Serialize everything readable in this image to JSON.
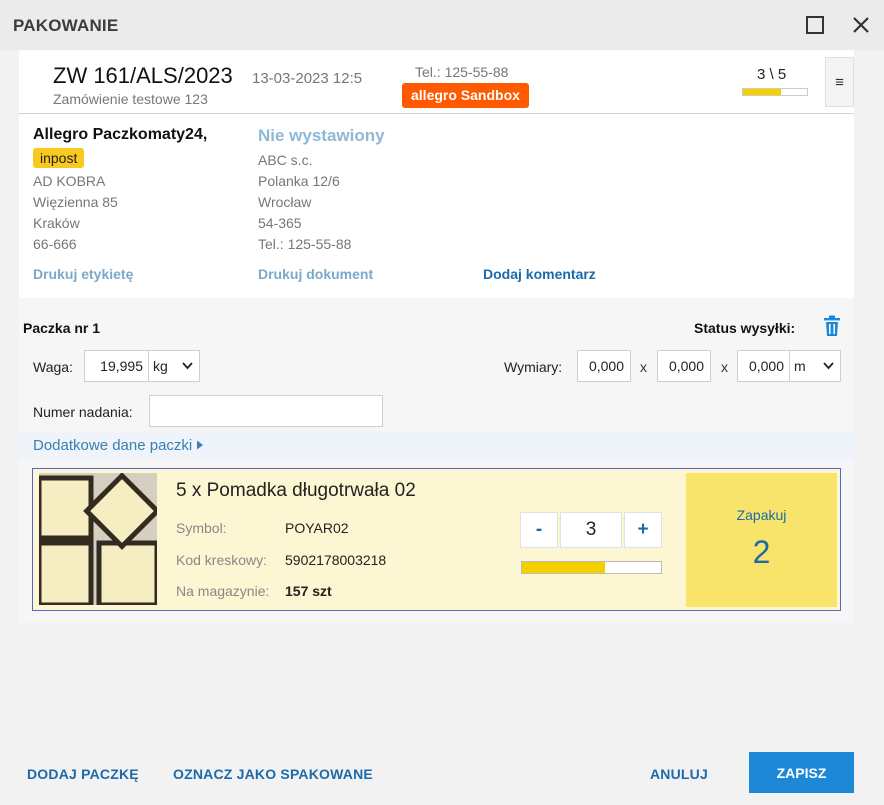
{
  "window": {
    "title": "PAKOWANIE"
  },
  "order": {
    "number": "ZW 161/ALS/2023",
    "date": "13-03-2023 12:5",
    "description": "Zamówienie testowe 123",
    "tel": "Tel.: 125-55-88",
    "source_badge": "allegro Sandbox",
    "counter": "3 \\ 5",
    "counter_progress": 0.6,
    "menu_icon": "≡"
  },
  "shipping": {
    "carrier": "Allegro Paczkomaty24,",
    "carrier_badge": "inpost",
    "address": [
      "AD KOBRA",
      "Więzienna 85",
      "Kraków",
      "66-666"
    ]
  },
  "document": {
    "status": "Nie wystawiony",
    "address": [
      "ABC s.c.",
      "Polanka 12/6",
      "Wrocław",
      "54-365",
      "Tel.:  125-55-88"
    ]
  },
  "links": {
    "print_label": "Drukuj etykietę",
    "print_document": "Drukuj dokument",
    "add_comment": "Dodaj komentarz"
  },
  "package": {
    "title": "Paczka nr 1",
    "status_label": "Status wysyłki:",
    "weight_label": "Waga:",
    "weight_value": "19,995",
    "weight_unit": "kg",
    "dimensions_label": "Wymiary:",
    "dim_1": "0,000",
    "dim_2": "0,000",
    "dim_3": "0,000",
    "dim_sep": "x",
    "dim_unit": "m",
    "tracking_label": "Numer nadania:",
    "tracking_value": "",
    "extra_data_link": "Dodatkowe dane paczki"
  },
  "item": {
    "title": "5 x Pomadka długotrwała 02",
    "symbol_label": "Symbol:",
    "symbol_value": "POYAR02",
    "barcode_label": "Kod kreskowy:",
    "barcode_value": "5902178003218",
    "stock_label": "Na magazynie:",
    "stock_value": "157 szt",
    "qty_minus": "-",
    "qty_value": "3",
    "qty_plus": "+",
    "qty_progress": 0.6,
    "pack_label": "Zapakuj",
    "pack_count": "2"
  },
  "footer": {
    "add_package": "DODAJ PACZKĘ",
    "mark_packed": "OZNACZ JAKO SPAKOWANE",
    "cancel": "ANULUJ",
    "save": "ZAPISZ"
  },
  "colors": {
    "accent": "#1e88d8",
    "link": "#1c6aaa",
    "allegro": "#ff5a00",
    "inpost": "#f9c920",
    "progress": "#f4d000",
    "item_bg": "#fdf6d2",
    "pack_bg": "#f8e46a"
  }
}
